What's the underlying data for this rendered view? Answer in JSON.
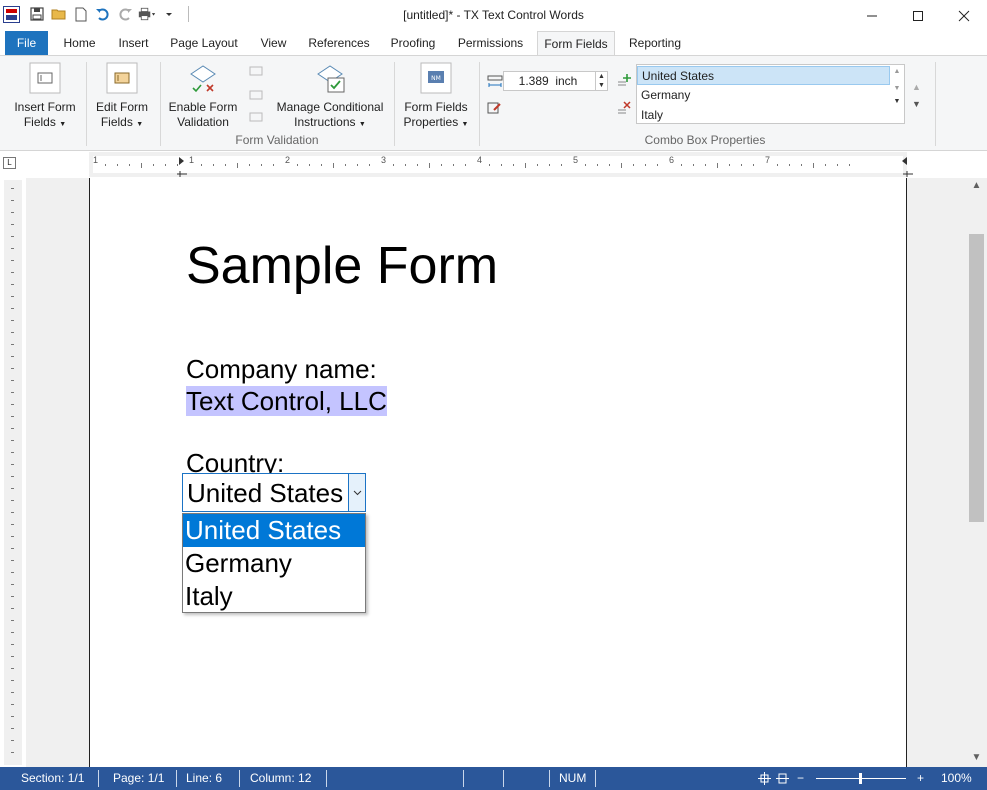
{
  "window": {
    "title": "[untitled]* - TX Text Control Words",
    "app_icon": "tx-text-control-icon",
    "controls": [
      "minimize",
      "maximize",
      "close"
    ]
  },
  "quick_access": [
    "save-icon",
    "open-folder-icon",
    "new-document-icon",
    "undo-icon",
    "redo-icon",
    "print-icon"
  ],
  "tabs": {
    "file": "File",
    "home": "Home",
    "insert": "Insert",
    "page_layout": "Page Layout",
    "view": "View",
    "references": "References",
    "proofing": "Proofing",
    "permissions": "Permissions",
    "form_fields": "Form Fields",
    "reporting": "Reporting",
    "active": "Form Fields"
  },
  "ribbon": {
    "insert_form_fields": [
      "Insert Form",
      "Fields"
    ],
    "edit_form_fields": [
      "Edit Form",
      "Fields"
    ],
    "enable_form_validation": [
      "Enable Form",
      "Validation"
    ],
    "manage_conditional_instructions": [
      "Manage Conditional",
      "Instructions"
    ],
    "form_fields_properties": [
      "Form Fields",
      "Properties"
    ],
    "group_form_validation": "Form Validation",
    "group_combo_box_properties": "Combo Box Properties",
    "width_value": "1.389",
    "width_unit": "inch",
    "combo_items": [
      "United States",
      "Germany",
      "Italy"
    ],
    "combo_selected": "United States"
  },
  "ruler": {
    "numbers": [
      "1",
      "1",
      "2",
      "3",
      "4",
      "5",
      "6",
      "7"
    ]
  },
  "document": {
    "title": "Sample Form",
    "company_label": "Company name:",
    "company_value": "Text Control, LLC",
    "country_label": "Country:",
    "country_value": "United States",
    "dropdown_options": [
      "United States",
      "Germany",
      "Italy"
    ],
    "dropdown_selected": "United States"
  },
  "status_bar": {
    "section": "Section: 1/1",
    "page": "Page: 1/1",
    "line": "Line: 6",
    "column": "Column: 12",
    "num": "NUM",
    "zoom_out": "−",
    "zoom_in": "+",
    "zoom": "100%"
  },
  "colors": {
    "accent": "#1e73be",
    "status_bar": "#2b579a",
    "highlight": "#c4c4ff",
    "dropdown_selected": "#0078d7"
  }
}
